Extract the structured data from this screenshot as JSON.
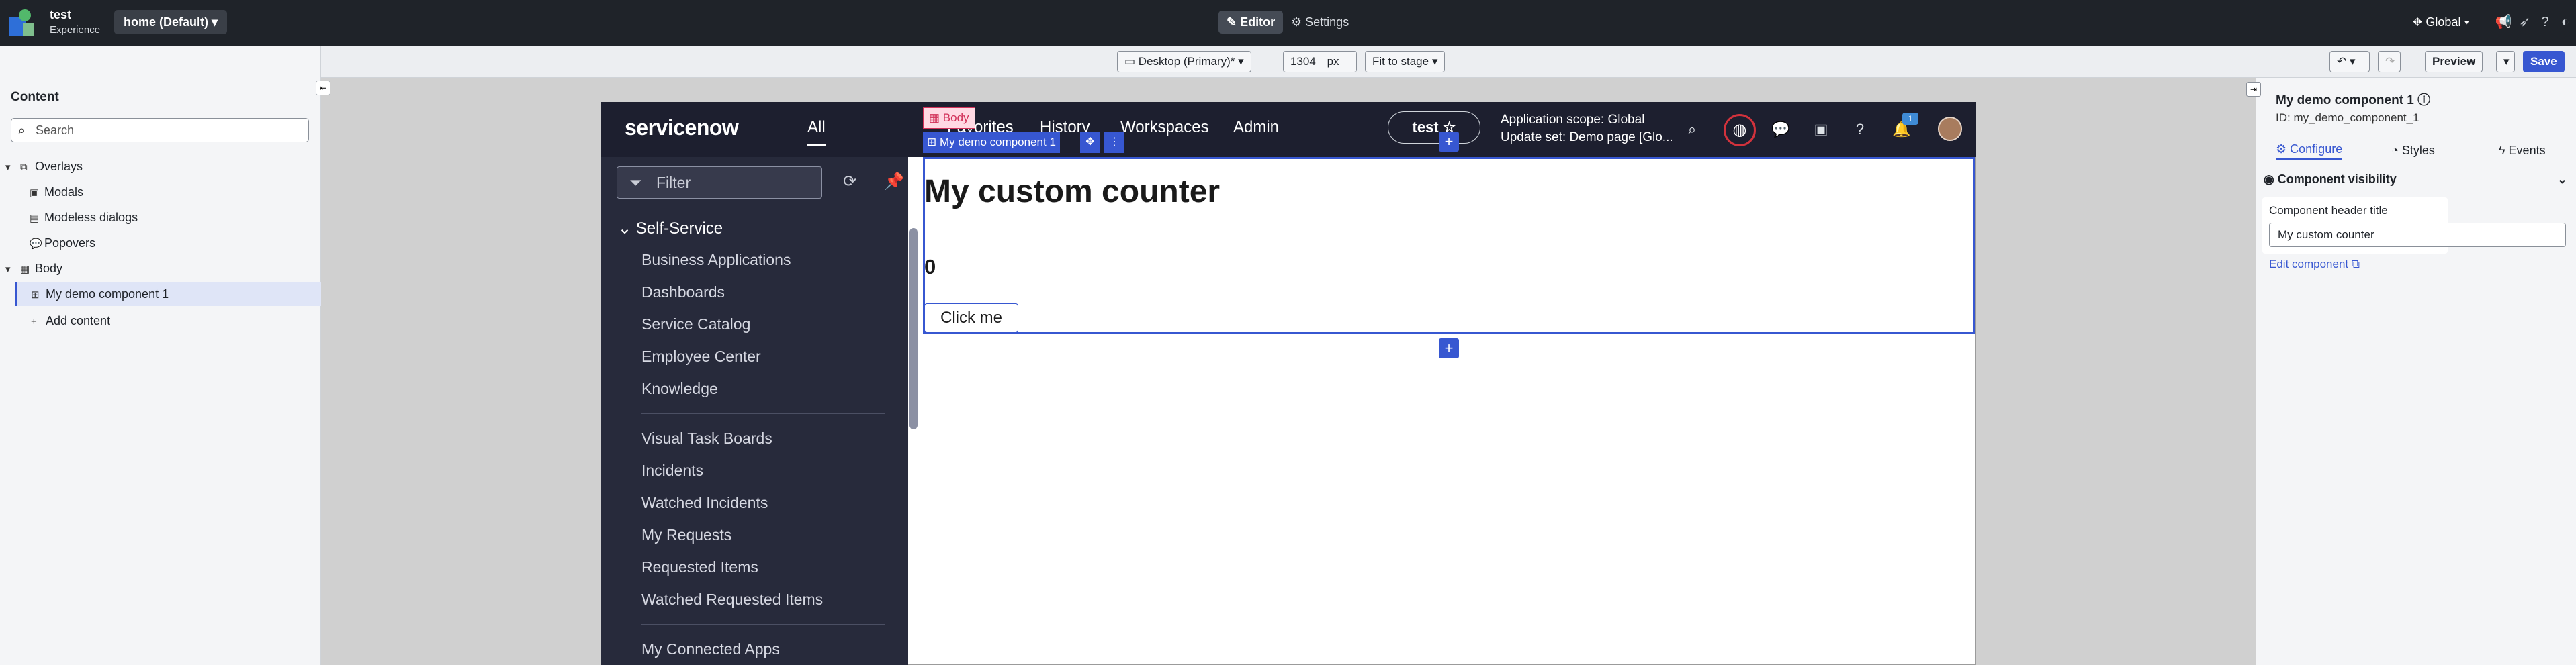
{
  "topbar": {
    "app_title": "test",
    "app_subtitle": "Experience",
    "page_select": "home (Default)",
    "editor_label": "Editor",
    "settings_label": "Settings",
    "scope_label": "Global"
  },
  "canvas_toolbar": {
    "device": "Desktop (Primary)*",
    "width_value": "1304",
    "width_unit": "px",
    "fit": "Fit to stage",
    "preview_label": "Preview",
    "save_label": "Save"
  },
  "left_panel": {
    "title": "Content",
    "search_placeholder": "Search",
    "tree": [
      {
        "label": "Overlays"
      },
      {
        "label": "Modals"
      },
      {
        "label": "Modeless dialogs"
      },
      {
        "label": "Popovers"
      },
      {
        "label": "Body"
      },
      {
        "label": "My demo component 1"
      },
      {
        "label": "Add content"
      }
    ]
  },
  "right_panel": {
    "component_name": "My demo component 1",
    "component_id": "ID: my_demo_component_1",
    "tabs": [
      "Configure",
      "Styles",
      "Events"
    ],
    "section_title": "Component visibility",
    "field_label": "Component header title",
    "field_value": "My custom counter",
    "edit_link": "Edit component"
  },
  "servicenow": {
    "logo": "servicenow",
    "nav_all": "All",
    "nav_items": [
      "Favorites",
      "History",
      "Workspaces",
      "Admin"
    ],
    "user_chip": "test",
    "scope_line1": "Application scope: Global",
    "scope_line2": "Update set: Demo page [Glo...",
    "notification_count": "1",
    "filter_placeholder": "Filter",
    "category": "Self-Service",
    "links_group1": [
      "Business Applications",
      "Dashboards",
      "Service Catalog",
      "Employee Center",
      "Knowledge"
    ],
    "links_group2": [
      "Visual Task Boards",
      "Incidents",
      "Watched Incidents",
      "My Requests",
      "Requested Items",
      "Watched Requested Items"
    ],
    "links_group3": [
      "My Connected Apps"
    ]
  },
  "component": {
    "body_tag": "Body",
    "label": "My demo component 1",
    "title": "My custom counter",
    "count": "0",
    "button": "Click me"
  },
  "colors": {
    "accent": "#3757d1",
    "topbar_bg": "#1f2329",
    "servicenow_header": "#1d1f2f",
    "servicenow_sidebar": "#272a3b"
  }
}
